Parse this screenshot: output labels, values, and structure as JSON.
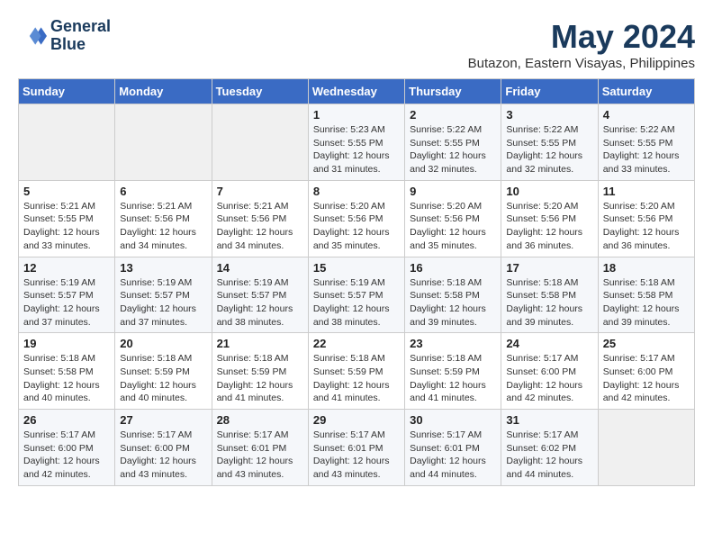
{
  "header": {
    "logo_line1": "General",
    "logo_line2": "Blue",
    "month_title": "May 2024",
    "location": "Butazon, Eastern Visayas, Philippines"
  },
  "weekdays": [
    "Sunday",
    "Monday",
    "Tuesday",
    "Wednesday",
    "Thursday",
    "Friday",
    "Saturday"
  ],
  "weeks": [
    [
      {
        "day": "",
        "sunrise": "",
        "sunset": "",
        "daylight": ""
      },
      {
        "day": "",
        "sunrise": "",
        "sunset": "",
        "daylight": ""
      },
      {
        "day": "",
        "sunrise": "",
        "sunset": "",
        "daylight": ""
      },
      {
        "day": "1",
        "sunrise": "Sunrise: 5:23 AM",
        "sunset": "Sunset: 5:55 PM",
        "daylight": "Daylight: 12 hours and 31 minutes."
      },
      {
        "day": "2",
        "sunrise": "Sunrise: 5:22 AM",
        "sunset": "Sunset: 5:55 PM",
        "daylight": "Daylight: 12 hours and 32 minutes."
      },
      {
        "day": "3",
        "sunrise": "Sunrise: 5:22 AM",
        "sunset": "Sunset: 5:55 PM",
        "daylight": "Daylight: 12 hours and 32 minutes."
      },
      {
        "day": "4",
        "sunrise": "Sunrise: 5:22 AM",
        "sunset": "Sunset: 5:55 PM",
        "daylight": "Daylight: 12 hours and 33 minutes."
      }
    ],
    [
      {
        "day": "5",
        "sunrise": "Sunrise: 5:21 AM",
        "sunset": "Sunset: 5:55 PM",
        "daylight": "Daylight: 12 hours and 33 minutes."
      },
      {
        "day": "6",
        "sunrise": "Sunrise: 5:21 AM",
        "sunset": "Sunset: 5:56 PM",
        "daylight": "Daylight: 12 hours and 34 minutes."
      },
      {
        "day": "7",
        "sunrise": "Sunrise: 5:21 AM",
        "sunset": "Sunset: 5:56 PM",
        "daylight": "Daylight: 12 hours and 34 minutes."
      },
      {
        "day": "8",
        "sunrise": "Sunrise: 5:20 AM",
        "sunset": "Sunset: 5:56 PM",
        "daylight": "Daylight: 12 hours and 35 minutes."
      },
      {
        "day": "9",
        "sunrise": "Sunrise: 5:20 AM",
        "sunset": "Sunset: 5:56 PM",
        "daylight": "Daylight: 12 hours and 35 minutes."
      },
      {
        "day": "10",
        "sunrise": "Sunrise: 5:20 AM",
        "sunset": "Sunset: 5:56 PM",
        "daylight": "Daylight: 12 hours and 36 minutes."
      },
      {
        "day": "11",
        "sunrise": "Sunrise: 5:20 AM",
        "sunset": "Sunset: 5:56 PM",
        "daylight": "Daylight: 12 hours and 36 minutes."
      }
    ],
    [
      {
        "day": "12",
        "sunrise": "Sunrise: 5:19 AM",
        "sunset": "Sunset: 5:57 PM",
        "daylight": "Daylight: 12 hours and 37 minutes."
      },
      {
        "day": "13",
        "sunrise": "Sunrise: 5:19 AM",
        "sunset": "Sunset: 5:57 PM",
        "daylight": "Daylight: 12 hours and 37 minutes."
      },
      {
        "day": "14",
        "sunrise": "Sunrise: 5:19 AM",
        "sunset": "Sunset: 5:57 PM",
        "daylight": "Daylight: 12 hours and 38 minutes."
      },
      {
        "day": "15",
        "sunrise": "Sunrise: 5:19 AM",
        "sunset": "Sunset: 5:57 PM",
        "daylight": "Daylight: 12 hours and 38 minutes."
      },
      {
        "day": "16",
        "sunrise": "Sunrise: 5:18 AM",
        "sunset": "Sunset: 5:58 PM",
        "daylight": "Daylight: 12 hours and 39 minutes."
      },
      {
        "day": "17",
        "sunrise": "Sunrise: 5:18 AM",
        "sunset": "Sunset: 5:58 PM",
        "daylight": "Daylight: 12 hours and 39 minutes."
      },
      {
        "day": "18",
        "sunrise": "Sunrise: 5:18 AM",
        "sunset": "Sunset: 5:58 PM",
        "daylight": "Daylight: 12 hours and 39 minutes."
      }
    ],
    [
      {
        "day": "19",
        "sunrise": "Sunrise: 5:18 AM",
        "sunset": "Sunset: 5:58 PM",
        "daylight": "Daylight: 12 hours and 40 minutes."
      },
      {
        "day": "20",
        "sunrise": "Sunrise: 5:18 AM",
        "sunset": "Sunset: 5:59 PM",
        "daylight": "Daylight: 12 hours and 40 minutes."
      },
      {
        "day": "21",
        "sunrise": "Sunrise: 5:18 AM",
        "sunset": "Sunset: 5:59 PM",
        "daylight": "Daylight: 12 hours and 41 minutes."
      },
      {
        "day": "22",
        "sunrise": "Sunrise: 5:18 AM",
        "sunset": "Sunset: 5:59 PM",
        "daylight": "Daylight: 12 hours and 41 minutes."
      },
      {
        "day": "23",
        "sunrise": "Sunrise: 5:18 AM",
        "sunset": "Sunset: 5:59 PM",
        "daylight": "Daylight: 12 hours and 41 minutes."
      },
      {
        "day": "24",
        "sunrise": "Sunrise: 5:17 AM",
        "sunset": "Sunset: 6:00 PM",
        "daylight": "Daylight: 12 hours and 42 minutes."
      },
      {
        "day": "25",
        "sunrise": "Sunrise: 5:17 AM",
        "sunset": "Sunset: 6:00 PM",
        "daylight": "Daylight: 12 hours and 42 minutes."
      }
    ],
    [
      {
        "day": "26",
        "sunrise": "Sunrise: 5:17 AM",
        "sunset": "Sunset: 6:00 PM",
        "daylight": "Daylight: 12 hours and 42 minutes."
      },
      {
        "day": "27",
        "sunrise": "Sunrise: 5:17 AM",
        "sunset": "Sunset: 6:00 PM",
        "daylight": "Daylight: 12 hours and 43 minutes."
      },
      {
        "day": "28",
        "sunrise": "Sunrise: 5:17 AM",
        "sunset": "Sunset: 6:01 PM",
        "daylight": "Daylight: 12 hours and 43 minutes."
      },
      {
        "day": "29",
        "sunrise": "Sunrise: 5:17 AM",
        "sunset": "Sunset: 6:01 PM",
        "daylight": "Daylight: 12 hours and 43 minutes."
      },
      {
        "day": "30",
        "sunrise": "Sunrise: 5:17 AM",
        "sunset": "Sunset: 6:01 PM",
        "daylight": "Daylight: 12 hours and 44 minutes."
      },
      {
        "day": "31",
        "sunrise": "Sunrise: 5:17 AM",
        "sunset": "Sunset: 6:02 PM",
        "daylight": "Daylight: 12 hours and 44 minutes."
      },
      {
        "day": "",
        "sunrise": "",
        "sunset": "",
        "daylight": ""
      }
    ]
  ]
}
